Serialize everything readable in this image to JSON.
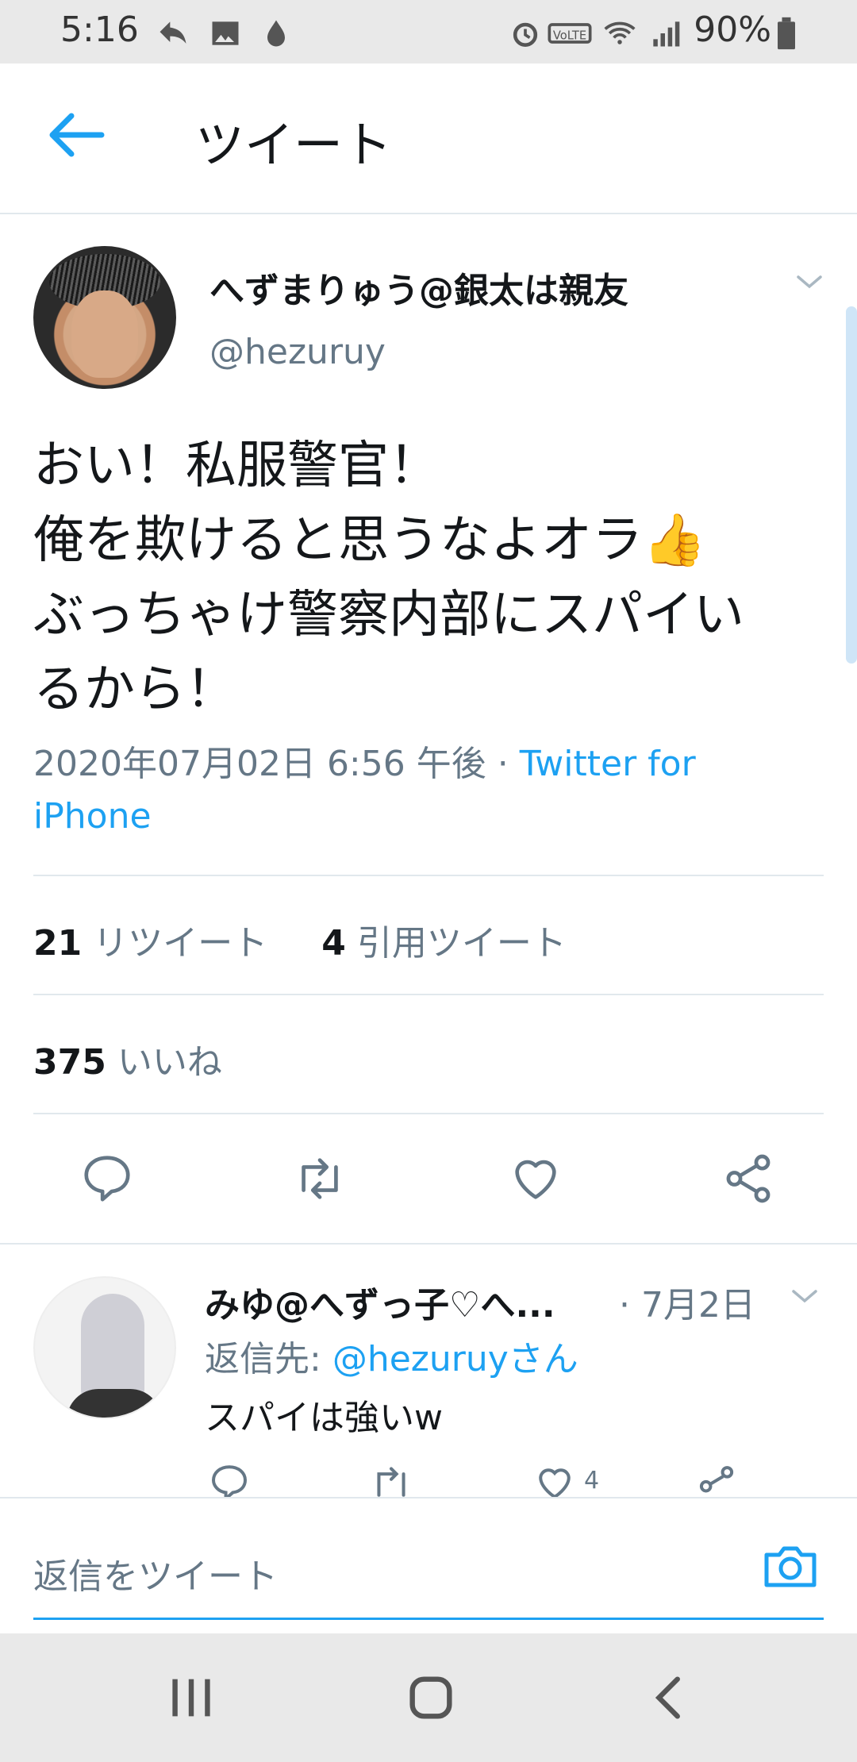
{
  "status_bar": {
    "time": "5:16",
    "battery": "90%"
  },
  "header": {
    "title": "ツイート"
  },
  "tweet": {
    "author_name": "へずまりゅう@銀太は親友",
    "author_handle": "@hezuruy",
    "text": "おい！私服警官！\n俺を欺けると思うなよオラ👍\nぶっちゃけ警察内部にスパイい\nるから！",
    "timestamp": "2020年07月02日 6:56 午後 · ",
    "source": "Twitter for iPhone",
    "retweets_count": "21",
    "retweets_label": "リツイート",
    "quotes_count": "4",
    "quotes_label": "引用ツイート",
    "likes_count": "375",
    "likes_label": "いいね"
  },
  "reply": {
    "author_name": "みゆ@へずっ子♡へ...",
    "date": "· 7月2日",
    "reply_to_label": "返信先: ",
    "reply_to_handle": "@hezuruyさん",
    "text": "スパイは強いw",
    "like_count": "4"
  },
  "compose": {
    "placeholder": "返信をツイート"
  },
  "colors": {
    "accent": "#1da1f2",
    "secondary_text": "#657786",
    "divider": "#e1e8ed"
  },
  "icons": [
    "back-arrow-icon",
    "chevron-down-icon",
    "reply-icon",
    "retweet-icon",
    "like-icon",
    "share-icon",
    "camera-icon",
    "recents-icon",
    "home-icon",
    "back-nav-icon"
  ]
}
